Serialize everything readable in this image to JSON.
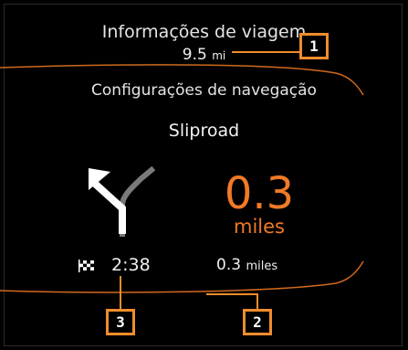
{
  "trip_info": {
    "title": "Informações de viagem",
    "distance_value": "9.5",
    "distance_unit": "mi"
  },
  "navigation": {
    "title": "Configurações de navegação",
    "road_name": "Sliproad",
    "next_turn_distance": "0.3",
    "next_turn_unit": "miles",
    "eta": "2:38",
    "remaining_distance": "0.3",
    "remaining_unit": "miles"
  },
  "callouts": {
    "one": "1",
    "two": "2",
    "three": "3"
  },
  "icons": {
    "turn": "turn-left-arrow-icon",
    "finish": "checkered-flag-icon"
  },
  "colors": {
    "accent": "#f07a26",
    "callout": "#ef8d2c",
    "background": "#000000"
  }
}
